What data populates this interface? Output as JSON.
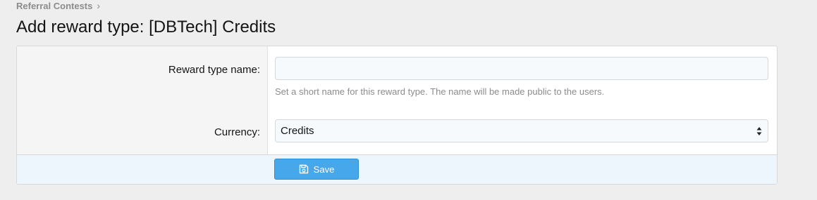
{
  "breadcrumb": {
    "items": [
      {
        "label": "Referral Contests"
      }
    ],
    "separator": "›"
  },
  "page": {
    "title": "Add reward type: [DBTech] Credits"
  },
  "form": {
    "reward_type_name": {
      "label": "Reward type name:",
      "value": "",
      "placeholder": "",
      "explain": "Set a short name for this reward type. The name will be made public to the users."
    },
    "currency": {
      "label": "Currency:",
      "selected": "Credits"
    },
    "save": {
      "label": "Save",
      "icon": "save-icon"
    }
  },
  "colors": {
    "page_background": "#eeeeee",
    "button_primary": "#47a7eb",
    "submit_row": "#edf6fd"
  }
}
